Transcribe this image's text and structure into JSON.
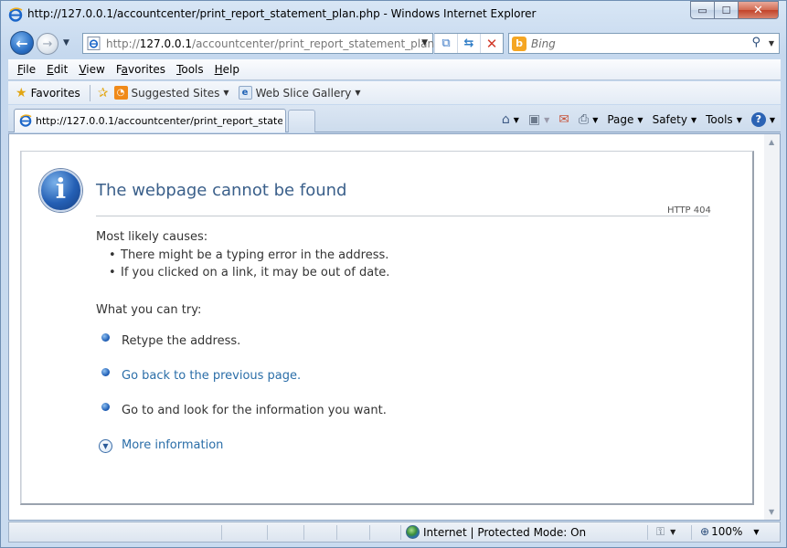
{
  "window": {
    "title": "http://127.0.0.1/accountcenter/print_report_statement_plan.php - Windows Internet Explorer",
    "buttons": {
      "minimize": "▭",
      "maximize": "☐",
      "close": "✕"
    }
  },
  "address_bar": {
    "url_prefix": "http://",
    "url_host": "127.0.0.1",
    "url_path": "/accountcenter/print_report_statement_plan.php"
  },
  "search": {
    "placeholder": "Bing",
    "provider_icon": "bing-icon"
  },
  "menu": [
    {
      "label": "File",
      "key": "F",
      "rest": "ile"
    },
    {
      "label": "Edit",
      "key": "E",
      "rest": "dit"
    },
    {
      "label": "View",
      "key": "V",
      "rest": "iew"
    },
    {
      "label": "Favorites",
      "key": "a",
      "pre": "F",
      "rest": "vorites"
    },
    {
      "label": "Tools",
      "key": "T",
      "rest": "ools"
    },
    {
      "label": "Help",
      "key": "H",
      "rest": "elp"
    }
  ],
  "favorites_bar": {
    "favorites_label": "Favorites",
    "sites": [
      {
        "label": "Suggested Sites",
        "icon": "suggested-sites-icon"
      },
      {
        "label": "Web Slice Gallery",
        "icon": "web-slice-icon"
      }
    ]
  },
  "tab": {
    "title": "http://127.0.0.1/accountcenter/print_report_state..."
  },
  "command_bar": {
    "page": "Page",
    "safety": "Safety",
    "tools": "Tools"
  },
  "error_page": {
    "title": "The webpage cannot be found",
    "http_code": "HTTP 404",
    "causes_heading": "Most likely causes:",
    "causes": [
      "There might be a typing error in the address.",
      "If you clicked on a link, it may be out of date."
    ],
    "try_heading": "What you can try:",
    "try_items": [
      "Retype the address.",
      "Go back to the previous page.",
      "Go to  and look for the information you want."
    ],
    "more_info": "More information"
  },
  "status_bar": {
    "zone": "Internet | Protected Mode: On",
    "zoom": "100%"
  }
}
